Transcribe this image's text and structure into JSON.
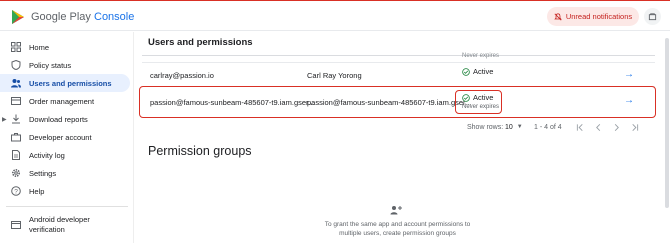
{
  "app": {
    "brand_prefix": "Google Play",
    "brand_suffix": "Console",
    "unread_label": "Unread notifications"
  },
  "sidebar": {
    "items": [
      {
        "label": "Home",
        "icon": "grid-icon",
        "active": false
      },
      {
        "label": "Policy status",
        "icon": "shield-icon",
        "active": false
      },
      {
        "label": "Users and permissions",
        "icon": "people-icon",
        "active": true
      },
      {
        "label": "Order management",
        "icon": "card-icon",
        "active": false
      },
      {
        "label": "Download reports",
        "icon": "download-icon",
        "active": false
      },
      {
        "label": "Developer account",
        "icon": "briefcase-icon",
        "active": false
      },
      {
        "label": "Activity log",
        "icon": "document-icon",
        "active": false
      },
      {
        "label": "Settings",
        "icon": "gear-icon",
        "active": false
      },
      {
        "label": "Help",
        "icon": "help-icon",
        "active": false
      }
    ],
    "footer": {
      "label_line1": "Android developer",
      "label_line2": "verification",
      "icon": "window-icon"
    }
  },
  "main": {
    "title": "Users and permissions",
    "prev_row_expires": "Never expires",
    "rows": [
      {
        "email": "carlray@passion.io",
        "name": "Carl Ray Yorong",
        "status": "Active",
        "expires": ""
      },
      {
        "email": "passion@famous-sunbeam-485607-t9.iam.gser...",
        "name": "passion@famous-sunbeam-485607-t9.iam.gser...",
        "status": "Active",
        "expires": "Never expires"
      }
    ],
    "pager": {
      "rows_label": "Show rows:",
      "rows_value": "10",
      "range": "1 - 4 of 4"
    },
    "permission_groups": {
      "title": "Permission groups",
      "empty_line1": "To grant the same app and account permissions to",
      "empty_line2": "multiple users, create permission groups"
    }
  },
  "colors": {
    "accent": "#1a73e8",
    "highlight": "#d93025",
    "active_nav_bg": "#e8f0fe",
    "status_green": "#188038"
  }
}
